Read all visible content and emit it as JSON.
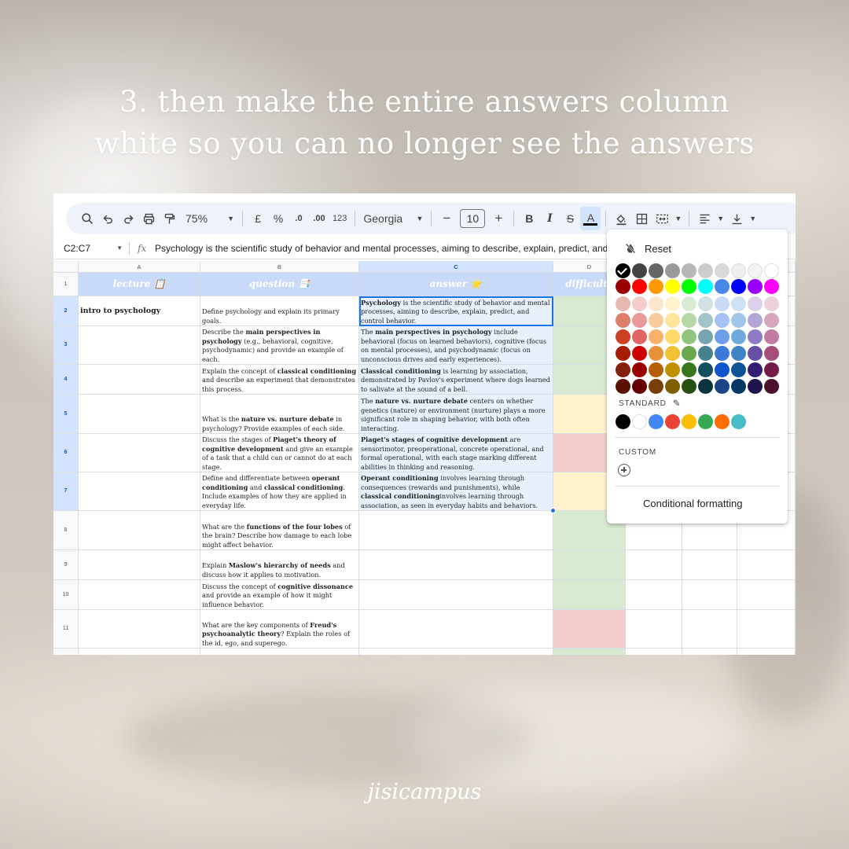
{
  "headline": {
    "line1": "3. then make the entire answers column",
    "line2": "white so you can no longer see the answers"
  },
  "brand": "jisicampus",
  "toolbar": {
    "zoom": "75%",
    "currency": "£",
    "percent": "%",
    "decrease_decimal": ".0",
    "increase_decimal": ".00",
    "number_format": "123",
    "font": "Georgia",
    "font_size": "10",
    "minus": "−",
    "plus": "+",
    "bold": "B",
    "italic": "I",
    "strikethrough": "S",
    "text_color": "A",
    "text_color_bar": "#000000"
  },
  "formula_bar": {
    "name_box": "C2:C7",
    "fx": "fx",
    "formula": "Psychology is the scientific study of behavior and mental processes, aiming to describe, explain, predict, and c"
  },
  "columns": [
    "A",
    "B",
    "C",
    "D"
  ],
  "header_row": {
    "row_number": "1",
    "lecture": "lecture 📋",
    "question": "question 📑",
    "answer": "answer ⭐",
    "difficulty": "difficulty"
  },
  "rows": [
    {
      "num": "2",
      "lecture": "intro to psychology",
      "question": [
        {
          "t": "Define psychology and explain its primary goals."
        }
      ],
      "answer": [
        {
          "t": "Psychology",
          "b": true
        },
        {
          "t": " is the scientific study of behavior and mental processes, aiming to describe, explain, predict, and control behavior."
        }
      ],
      "difficulty": "green"
    },
    {
      "num": "3",
      "lecture": "",
      "question": [
        {
          "t": "Describe the "
        },
        {
          "t": "main perspectives in psychology",
          "b": true
        },
        {
          "t": " (e.g., behavioral, cognitive, psychodynamic) and provide an example of each."
        }
      ],
      "answer": [
        {
          "t": "The "
        },
        {
          "t": "main perspectives in psychology",
          "b": true
        },
        {
          "t": " include behavioral (focus on learned behaviors), cognitive (focus on mental processes), and psychodynamic (focus on unconscious drives and early experiences)."
        }
      ],
      "difficulty": "green"
    },
    {
      "num": "4",
      "lecture": "",
      "question": [
        {
          "t": "Explain the concept of "
        },
        {
          "t": "classical conditioning",
          "b": true
        },
        {
          "t": " and describe an experiment that demonstrates this process."
        }
      ],
      "answer": [
        {
          "t": "Classical conditioning",
          "b": true
        },
        {
          "t": " is learning by association, demonstrated by Pavlov's experiment where dogs learned to salivate at the sound of a bell."
        }
      ],
      "difficulty": "green"
    },
    {
      "num": "5",
      "lecture": "",
      "question": [
        {
          "t": "What is the "
        },
        {
          "t": "nature vs. nurture debate",
          "b": true
        },
        {
          "t": " in psychology? Provide examples of each side."
        }
      ],
      "answer": [
        {
          "t": "The "
        },
        {
          "t": "nature vs. nurture debate",
          "b": true
        },
        {
          "t": " centers on whether genetics (nature) or environment (nurture) plays a more significant role in shaping behavior, with both often interacting."
        }
      ],
      "difficulty": "yellow"
    },
    {
      "num": "6",
      "lecture": "",
      "question": [
        {
          "t": "Discuss the stages of "
        },
        {
          "t": "Piaget's theory of cognitive development",
          "b": true
        },
        {
          "t": " and give an example of a task that a child can or cannot do at each stage."
        }
      ],
      "answer": [
        {
          "t": "Piaget's stages of cognitive development",
          "b": true
        },
        {
          "t": " are sensorimotor, preoperational, concrete operational, and formal operational, with each stage marking different abilities in thinking and reasoning."
        }
      ],
      "difficulty": "red"
    },
    {
      "num": "7",
      "lecture": "",
      "question": [
        {
          "t": "Define and differentiate between "
        },
        {
          "t": "operant conditioning",
          "b": true
        },
        {
          "t": " and "
        },
        {
          "t": "classical conditioning",
          "b": true
        },
        {
          "t": ". Include examples of how they are applied in everyday life."
        }
      ],
      "answer": [
        {
          "t": "Operant conditioning",
          "b": true
        },
        {
          "t": " involves learning through consequences (rewards and punishments), while "
        },
        {
          "t": "classical conditioning",
          "b": true
        },
        {
          "t": "involves learning through association, as seen in everyday habits and behaviors."
        }
      ],
      "difficulty": "yellow"
    },
    {
      "num": "8",
      "lecture": "",
      "question": [
        {
          "t": "What are the "
        },
        {
          "t": "functions of the four lobes",
          "b": true
        },
        {
          "t": " of the brain? Describe how damage to each lobe might affect behavior."
        }
      ],
      "answer": [],
      "difficulty": "green"
    },
    {
      "num": "9",
      "lecture": "",
      "question": [
        {
          "t": "Explain "
        },
        {
          "t": "Maslow's hierarchy of needs",
          "b": true
        },
        {
          "t": " and discuss how it applies to motivation."
        }
      ],
      "answer": [],
      "difficulty": "green"
    },
    {
      "num": "10",
      "lecture": "",
      "question": [
        {
          "t": "Discuss the concept of "
        },
        {
          "t": "cognitive dissonance",
          "b": true
        },
        {
          "t": " and provide an example of how it might influence behavior."
        }
      ],
      "answer": [],
      "difficulty": "green"
    },
    {
      "num": "11",
      "lecture": "",
      "question": [
        {
          "t": "What are the key components of "
        },
        {
          "t": "Freud's psychoanalytic theory",
          "b": true
        },
        {
          "t": "? Explain the roles of the id, ego, and superego."
        }
      ],
      "answer": [],
      "difficulty": "red"
    }
  ],
  "difficulty_colors": {
    "green": "#d9ead3",
    "yellow": "#fff2cc",
    "red": "#f4cccc"
  },
  "palette": {
    "reset_label": "Reset",
    "standard_label": "STANDARD",
    "custom_label": "CUSTOM",
    "conditional_formatting_label": "Conditional formatting",
    "selected": "#000000",
    "grid": [
      [
        "#000000",
        "#434343",
        "#666666",
        "#999999",
        "#b7b7b7",
        "#cccccc",
        "#d9d9d9",
        "#efefef",
        "#f3f3f3",
        "#ffffff"
      ],
      [
        "#980000",
        "#ff0000",
        "#ff9900",
        "#ffff00",
        "#00ff00",
        "#00ffff",
        "#4a86e8",
        "#0000ff",
        "#9900ff",
        "#ff00ff"
      ],
      [
        "#e6b8af",
        "#f4cccc",
        "#fce5cd",
        "#fff2cc",
        "#d9ead3",
        "#d0e0e3",
        "#c9daf8",
        "#cfe2f3",
        "#d9d2e9",
        "#ead1dc"
      ],
      [
        "#dd7e6b",
        "#ea9999",
        "#f9cb9c",
        "#ffe599",
        "#b6d7a8",
        "#a2c4c9",
        "#a4c2f4",
        "#9fc5e8",
        "#b4a7d6",
        "#d5a6bd"
      ],
      [
        "#cc4125",
        "#e06666",
        "#f6b26b",
        "#ffd966",
        "#93c47d",
        "#76a5af",
        "#6d9eeb",
        "#6fa8dc",
        "#8e7cc3",
        "#c27ba0"
      ],
      [
        "#a61c00",
        "#cc0000",
        "#e69138",
        "#f1c232",
        "#6aa84f",
        "#45818e",
        "#3c78d8",
        "#3d85c6",
        "#674ea7",
        "#a64d79"
      ],
      [
        "#85200c",
        "#990000",
        "#b45f06",
        "#bf9000",
        "#38761d",
        "#134f5c",
        "#1155cc",
        "#0b5394",
        "#351c75",
        "#741b47"
      ],
      [
        "#5b0f00",
        "#660000",
        "#783f04",
        "#7f6000",
        "#274e13",
        "#0c343d",
        "#1c4587",
        "#073763",
        "#20124d",
        "#4c1130"
      ]
    ],
    "standard": [
      "#000000",
      "#ffffff",
      "#4285f4",
      "#ea4335",
      "#fbbc04",
      "#34a853",
      "#ff6d01",
      "#46bdc6"
    ]
  }
}
